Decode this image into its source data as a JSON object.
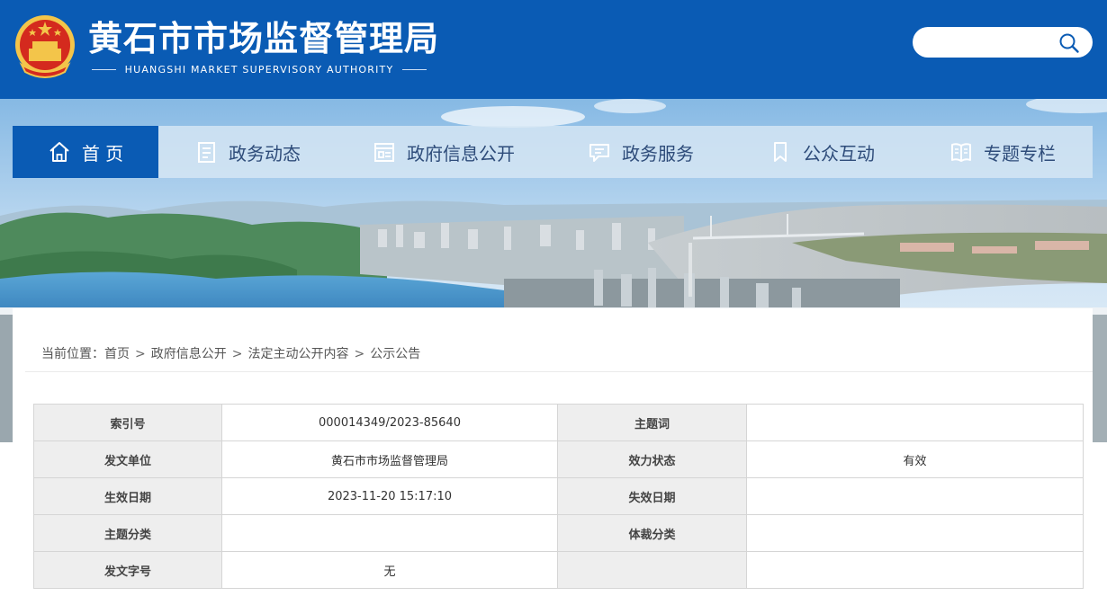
{
  "header": {
    "title": "黄石市市场监督管理局",
    "subtitle": "HUANGSHI MARKET SUPERVISORY AUTHORITY",
    "search": {
      "placeholder": "",
      "icon": "search-icon"
    },
    "brand_color": "#0a5bb4"
  },
  "nav": {
    "items": [
      {
        "label": "首 页",
        "icon": "home-icon",
        "active": true
      },
      {
        "label": "政务动态",
        "icon": "document-list-icon",
        "active": false
      },
      {
        "label": "政府信息公开",
        "icon": "info-disclosure-icon",
        "active": false
      },
      {
        "label": "政务服务",
        "icon": "chat-service-icon",
        "active": false
      },
      {
        "label": "公众互动",
        "icon": "bookmark-icon",
        "active": false
      },
      {
        "label": "专题专栏",
        "icon": "book-icon",
        "active": false
      }
    ]
  },
  "breadcrumb": {
    "prefix": "当前位置：",
    "items": [
      "首页",
      "政府信息公开",
      "法定主动公开内容",
      "公示公告"
    ],
    "separator": ">"
  },
  "info_table": {
    "rows": [
      {
        "label1": "索引号",
        "value1": "000014349/2023-85640",
        "label2": "主题词",
        "value2": ""
      },
      {
        "label1": "发文单位",
        "value1": "黄石市市场监督管理局",
        "label2": "效力状态",
        "value2": "有效"
      },
      {
        "label1": "生效日期",
        "value1": "2023-11-20 15:17:10",
        "label2": "失效日期",
        "value2": ""
      },
      {
        "label1": "主题分类",
        "value1": "",
        "label2": "体裁分类",
        "value2": ""
      },
      {
        "label1": "发文字号",
        "value1": "无",
        "label2": "",
        "value2": ""
      }
    ]
  }
}
